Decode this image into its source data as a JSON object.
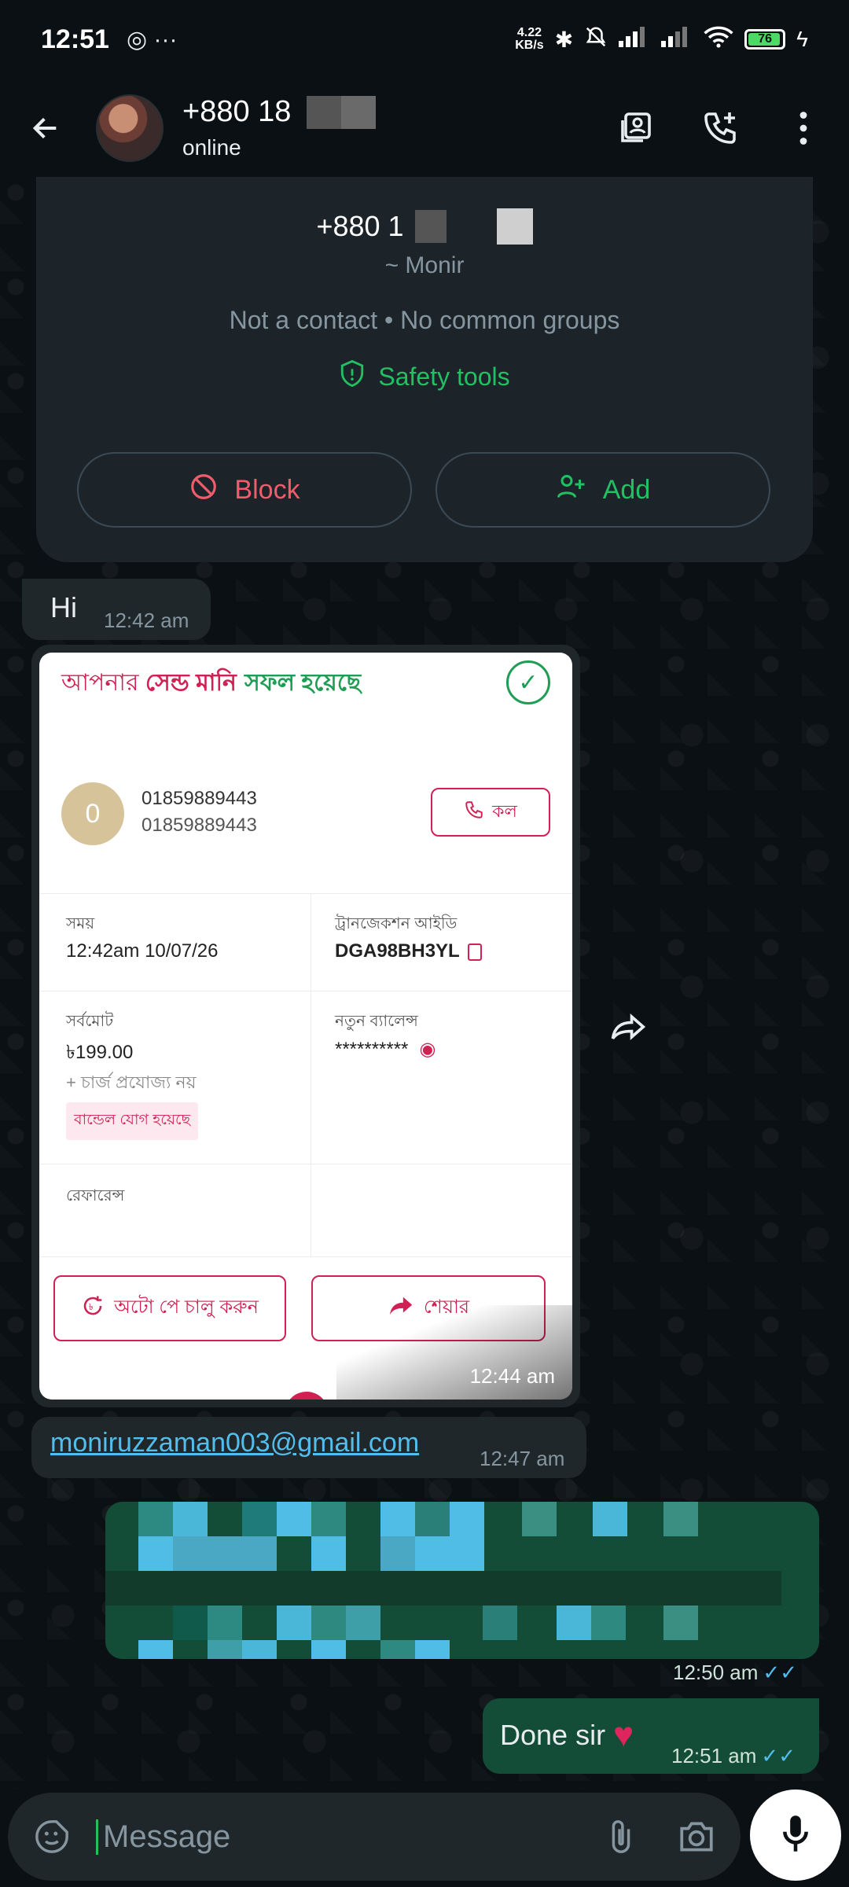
{
  "status_bar": {
    "time": "12:51",
    "left_icons": "◎ ···",
    "network_speed_value": "4.22",
    "network_speed_unit": "KB/s",
    "battery_level": "76"
  },
  "header": {
    "title": "+880 18",
    "status": "online"
  },
  "info_card": {
    "number": "+880 1",
    "name": "~ Monir",
    "subtitle": "Not a contact • No common groups",
    "safety_tools": "Safety tools",
    "block_label": "Block",
    "add_label": "Add"
  },
  "messages": {
    "hi": {
      "text": "Hi",
      "time": "12:42 am"
    },
    "receipt": {
      "head_part1": "আপনার ",
      "head_part2": "সেন্ড মানি",
      "head_part3": "সফল হয়েছে",
      "avatar_letter": "0",
      "number_primary": "01859889443",
      "number_secondary": "01859889443",
      "call_label": "কল",
      "time_label": "সময়",
      "time_value": "12:42am 10/07/26",
      "trxid_label": "ট্রানজেকশন আইডি",
      "trxid_value": "DGA98BH3YL",
      "total_label": "সর্বমোট",
      "total_value": "৳199.00",
      "charge_note": "+ চার্জ প্রযোজ্য নয়",
      "bundle_badge": "বান্ডেল যোগ হয়েছে",
      "balance_label": "নতুন ব্যালেন্স",
      "balance_value": "**********",
      "reference_label": "রেফারেন্স",
      "autopay_label": "অটো পে চালু করুন",
      "share_label": "শেয়ার",
      "time": "12:44 am"
    },
    "email": {
      "text": "moniruzzaman003@gmail.com",
      "time": "12:47 am"
    },
    "redacted": {
      "time": "12:50 am"
    },
    "done": {
      "text": "Done sir",
      "time": "12:51 am"
    }
  },
  "input": {
    "placeholder": "Message"
  },
  "colors": {
    "accent_green": "#21c063",
    "outgoing_bubble": "#144d37",
    "incoming_bubble": "#1f272a",
    "block_red": "#f15c6d",
    "bkash_pink": "#d12053"
  }
}
